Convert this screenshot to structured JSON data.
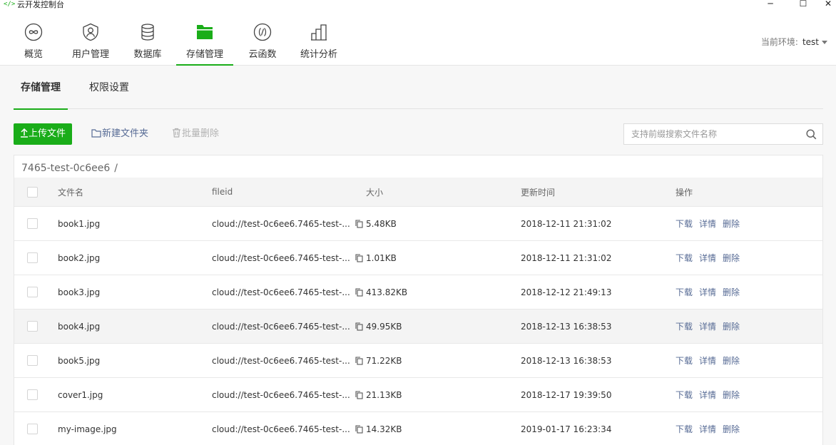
{
  "titlebar": {
    "icon": "</>",
    "title": "云开发控制台",
    "minimize": "─",
    "maximize": "☐",
    "close": "✕"
  },
  "nav": [
    {
      "label": "概览",
      "icon": "infinity-icon"
    },
    {
      "label": "用户管理",
      "icon": "user-shield-icon"
    },
    {
      "label": "数据库",
      "icon": "database-icon"
    },
    {
      "label": "存储管理",
      "icon": "folder-icon",
      "active": true
    },
    {
      "label": "云函数",
      "icon": "function-icon"
    },
    {
      "label": "统计分析",
      "icon": "bar-chart-icon"
    }
  ],
  "env": {
    "label": "当前环境:",
    "value": "test"
  },
  "tabs": [
    {
      "label": "存储管理",
      "active": true
    },
    {
      "label": "权限设置",
      "active": false
    }
  ],
  "actions": {
    "upload": "上传文件",
    "new_folder": "新建文件夹",
    "batch_delete": "批量删除"
  },
  "search": {
    "placeholder": "支持前缀搜索文件名称",
    "value": ""
  },
  "breadcrumb": {
    "path": "7465-test-0c6ee6",
    "separator": "/"
  },
  "table": {
    "columns": {
      "name": "文件名",
      "fileid": "fileid",
      "size": "大小",
      "updated": "更新时间",
      "ops": "操作"
    },
    "ops": {
      "download": "下载",
      "details": "详情",
      "delete": "删除"
    },
    "rows": [
      {
        "name": "book1.jpg",
        "fileid": "cloud://test-0c6ee6.7465-test-...",
        "size": "5.48KB",
        "updated": "2018-12-11 21:31:02"
      },
      {
        "name": "book2.jpg",
        "fileid": "cloud://test-0c6ee6.7465-test-...",
        "size": "1.01KB",
        "updated": "2018-12-11 21:31:02"
      },
      {
        "name": "book3.jpg",
        "fileid": "cloud://test-0c6ee6.7465-test-...",
        "size": "413.82KB",
        "updated": "2018-12-12 21:49:13"
      },
      {
        "name": "book4.jpg",
        "fileid": "cloud://test-0c6ee6.7465-test-...",
        "size": "49.95KB",
        "updated": "2018-12-13 16:38:53",
        "highlighted": true
      },
      {
        "name": "book5.jpg",
        "fileid": "cloud://test-0c6ee6.7465-test-...",
        "size": "71.22KB",
        "updated": "2018-12-13 16:38:53"
      },
      {
        "name": "cover1.jpg",
        "fileid": "cloud://test-0c6ee6.7465-test-...",
        "size": "21.13KB",
        "updated": "2018-12-17 19:39:50"
      },
      {
        "name": "my-image.jpg",
        "fileid": "cloud://test-0c6ee6.7465-test-...",
        "size": "14.32KB",
        "updated": "2019-01-17 16:23:34"
      }
    ]
  },
  "colors": {
    "accent": "#1aad19",
    "link": "#576b95"
  }
}
